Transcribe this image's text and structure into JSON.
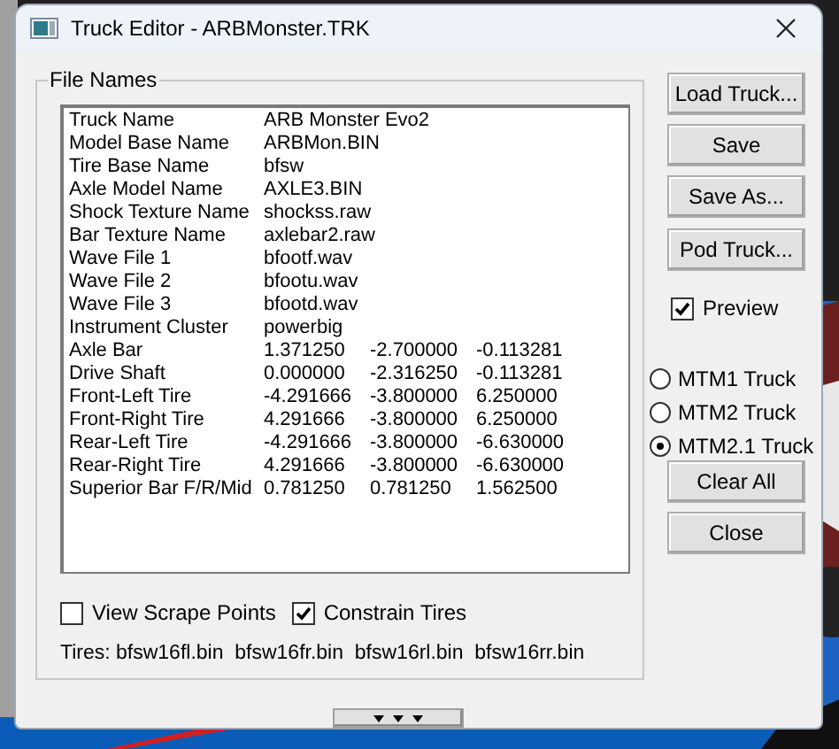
{
  "window": {
    "title": "Truck Editor - ARBMonster.TRK"
  },
  "group": {
    "label": "File Names"
  },
  "rows": [
    {
      "label": "Truck Name",
      "values": [
        "ARB Monster Evo2"
      ]
    },
    {
      "label": "Model Base Name",
      "values": [
        "ARBMon.BIN"
      ]
    },
    {
      "label": "Tire Base Name",
      "values": [
        "bfsw"
      ]
    },
    {
      "label": "Axle Model Name",
      "values": [
        "AXLE3.BIN"
      ]
    },
    {
      "label": "Shock Texture Name",
      "values": [
        "shockss.raw"
      ]
    },
    {
      "label": "Bar Texture Name",
      "values": [
        "axlebar2.raw"
      ]
    },
    {
      "label": "Wave File 1",
      "values": [
        "bfootf.wav"
      ]
    },
    {
      "label": "Wave File 2",
      "values": [
        "bfootu.wav"
      ]
    },
    {
      "label": "Wave File 3",
      "values": [
        "bfootd.wav"
      ]
    },
    {
      "label": "Instrument Cluster",
      "values": [
        "powerbig"
      ]
    },
    {
      "label": "Axle Bar",
      "values": [
        "1.371250",
        "-2.700000",
        "-0.113281"
      ]
    },
    {
      "label": "Drive Shaft",
      "values": [
        "0.000000",
        "-2.316250",
        "-0.113281"
      ]
    },
    {
      "label": "Front-Left Tire",
      "values": [
        "-4.291666",
        "-3.800000",
        "6.250000"
      ]
    },
    {
      "label": "Front-Right Tire",
      "values": [
        "4.291666",
        "-3.800000",
        "6.250000"
      ]
    },
    {
      "label": "Rear-Left Tire",
      "values": [
        "-4.291666",
        "-3.800000",
        "-6.630000"
      ]
    },
    {
      "label": "Rear-Right Tire",
      "values": [
        "4.291666",
        "-3.800000",
        "-6.630000"
      ]
    },
    {
      "label": "Superior Bar F/R/Mid",
      "values": [
        "0.781250",
        "0.781250",
        "1.562500"
      ]
    }
  ],
  "options": [
    {
      "label": "View Scrape Points",
      "checked": false
    },
    {
      "label": "Constrain Tires",
      "checked": true
    }
  ],
  "tires": "Tires: bfsw16fl.bin  bfsw16fr.bin  bfsw16rl.bin  bfsw16rr.bin",
  "top_buttons": [
    "Load Truck...",
    "Save",
    "Save As...",
    "Pod Truck..."
  ],
  "preview": {
    "label": "Preview",
    "checked": true
  },
  "versions": [
    {
      "label": "MTM1 Truck",
      "selected": false
    },
    {
      "label": "MTM2 Truck",
      "selected": false
    },
    {
      "label": "MTM2.1 Truck",
      "selected": true
    }
  ],
  "bottom_buttons": [
    "Clear All",
    "Close"
  ]
}
